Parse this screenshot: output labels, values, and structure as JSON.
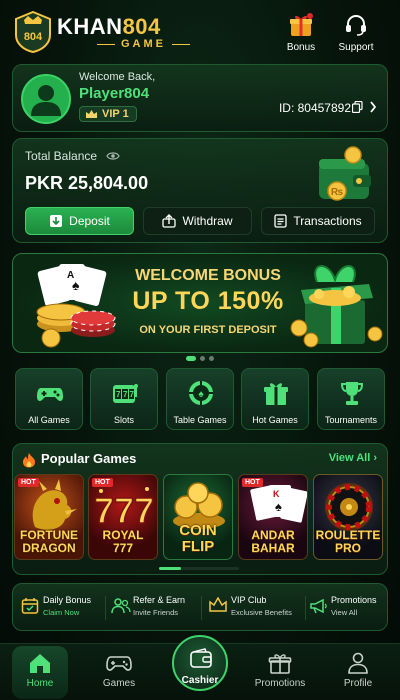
{
  "header": {
    "logo_badge_text": "804",
    "logo_main": "KHAN",
    "logo_num": "804",
    "logo_sub": "GAME",
    "bonus_label": "Bonus",
    "support_label": "Support"
  },
  "profile": {
    "welcome": "Welcome Back,",
    "name": "Player804",
    "vip": "VIP 1",
    "id_text": "ID: 80457892"
  },
  "balance": {
    "label": "Total Balance",
    "amount": "PKR 25,804.00",
    "deposit": "Deposit",
    "withdraw": "Withdraw",
    "transactions": "Transactions"
  },
  "banner": {
    "line1": "WELCOME BONUS",
    "line2": "UP TO 150%",
    "line3": "ON YOUR FIRST DEPOSIT",
    "active_slide": 1,
    "slide_count": 3
  },
  "categories": [
    {
      "label": "All Games",
      "icon": "gamepad-icon"
    },
    {
      "label": "Slots",
      "icon": "slots-icon"
    },
    {
      "label": "Table Games",
      "icon": "chip-icon"
    },
    {
      "label": "Hot Games",
      "icon": "gift-icon"
    },
    {
      "label": "Tournaments",
      "icon": "trophy-icon"
    }
  ],
  "popular": {
    "title": "Popular Games",
    "view_all": "View All",
    "hot_label": "HOT",
    "games": [
      {
        "line1": "FORTUNE",
        "line2": "DRAGON",
        "hot": true
      },
      {
        "line1": "ROYAL",
        "line2": "777",
        "hot": true
      },
      {
        "line1": "COIN",
        "line2": "FLIP",
        "hot": false
      },
      {
        "line1": "ANDAR",
        "line2": "BAHAR",
        "hot": true
      },
      {
        "line1": "ROULETTE",
        "line2": "PRO",
        "hot": false
      }
    ]
  },
  "promos": [
    {
      "title": "Daily Bonus",
      "sub": "Claim Now",
      "icon": "calendar-icon"
    },
    {
      "title": "Refer & Earn",
      "sub": "Invite Friends",
      "icon": "users-icon"
    },
    {
      "title": "VIP Club",
      "sub": "Exclusive Benefits",
      "icon": "crown-icon"
    },
    {
      "title": "Promotions",
      "sub": "View All",
      "icon": "megaphone-icon"
    }
  ],
  "bottom_nav": {
    "home": "Home",
    "games": "Games",
    "cashier": "Cashier",
    "promotions": "Promotions",
    "profile": "Profile"
  },
  "colors": {
    "accent_green": "#4fe07a",
    "gold": "#f5c542",
    "hot_red": "#e02929"
  }
}
